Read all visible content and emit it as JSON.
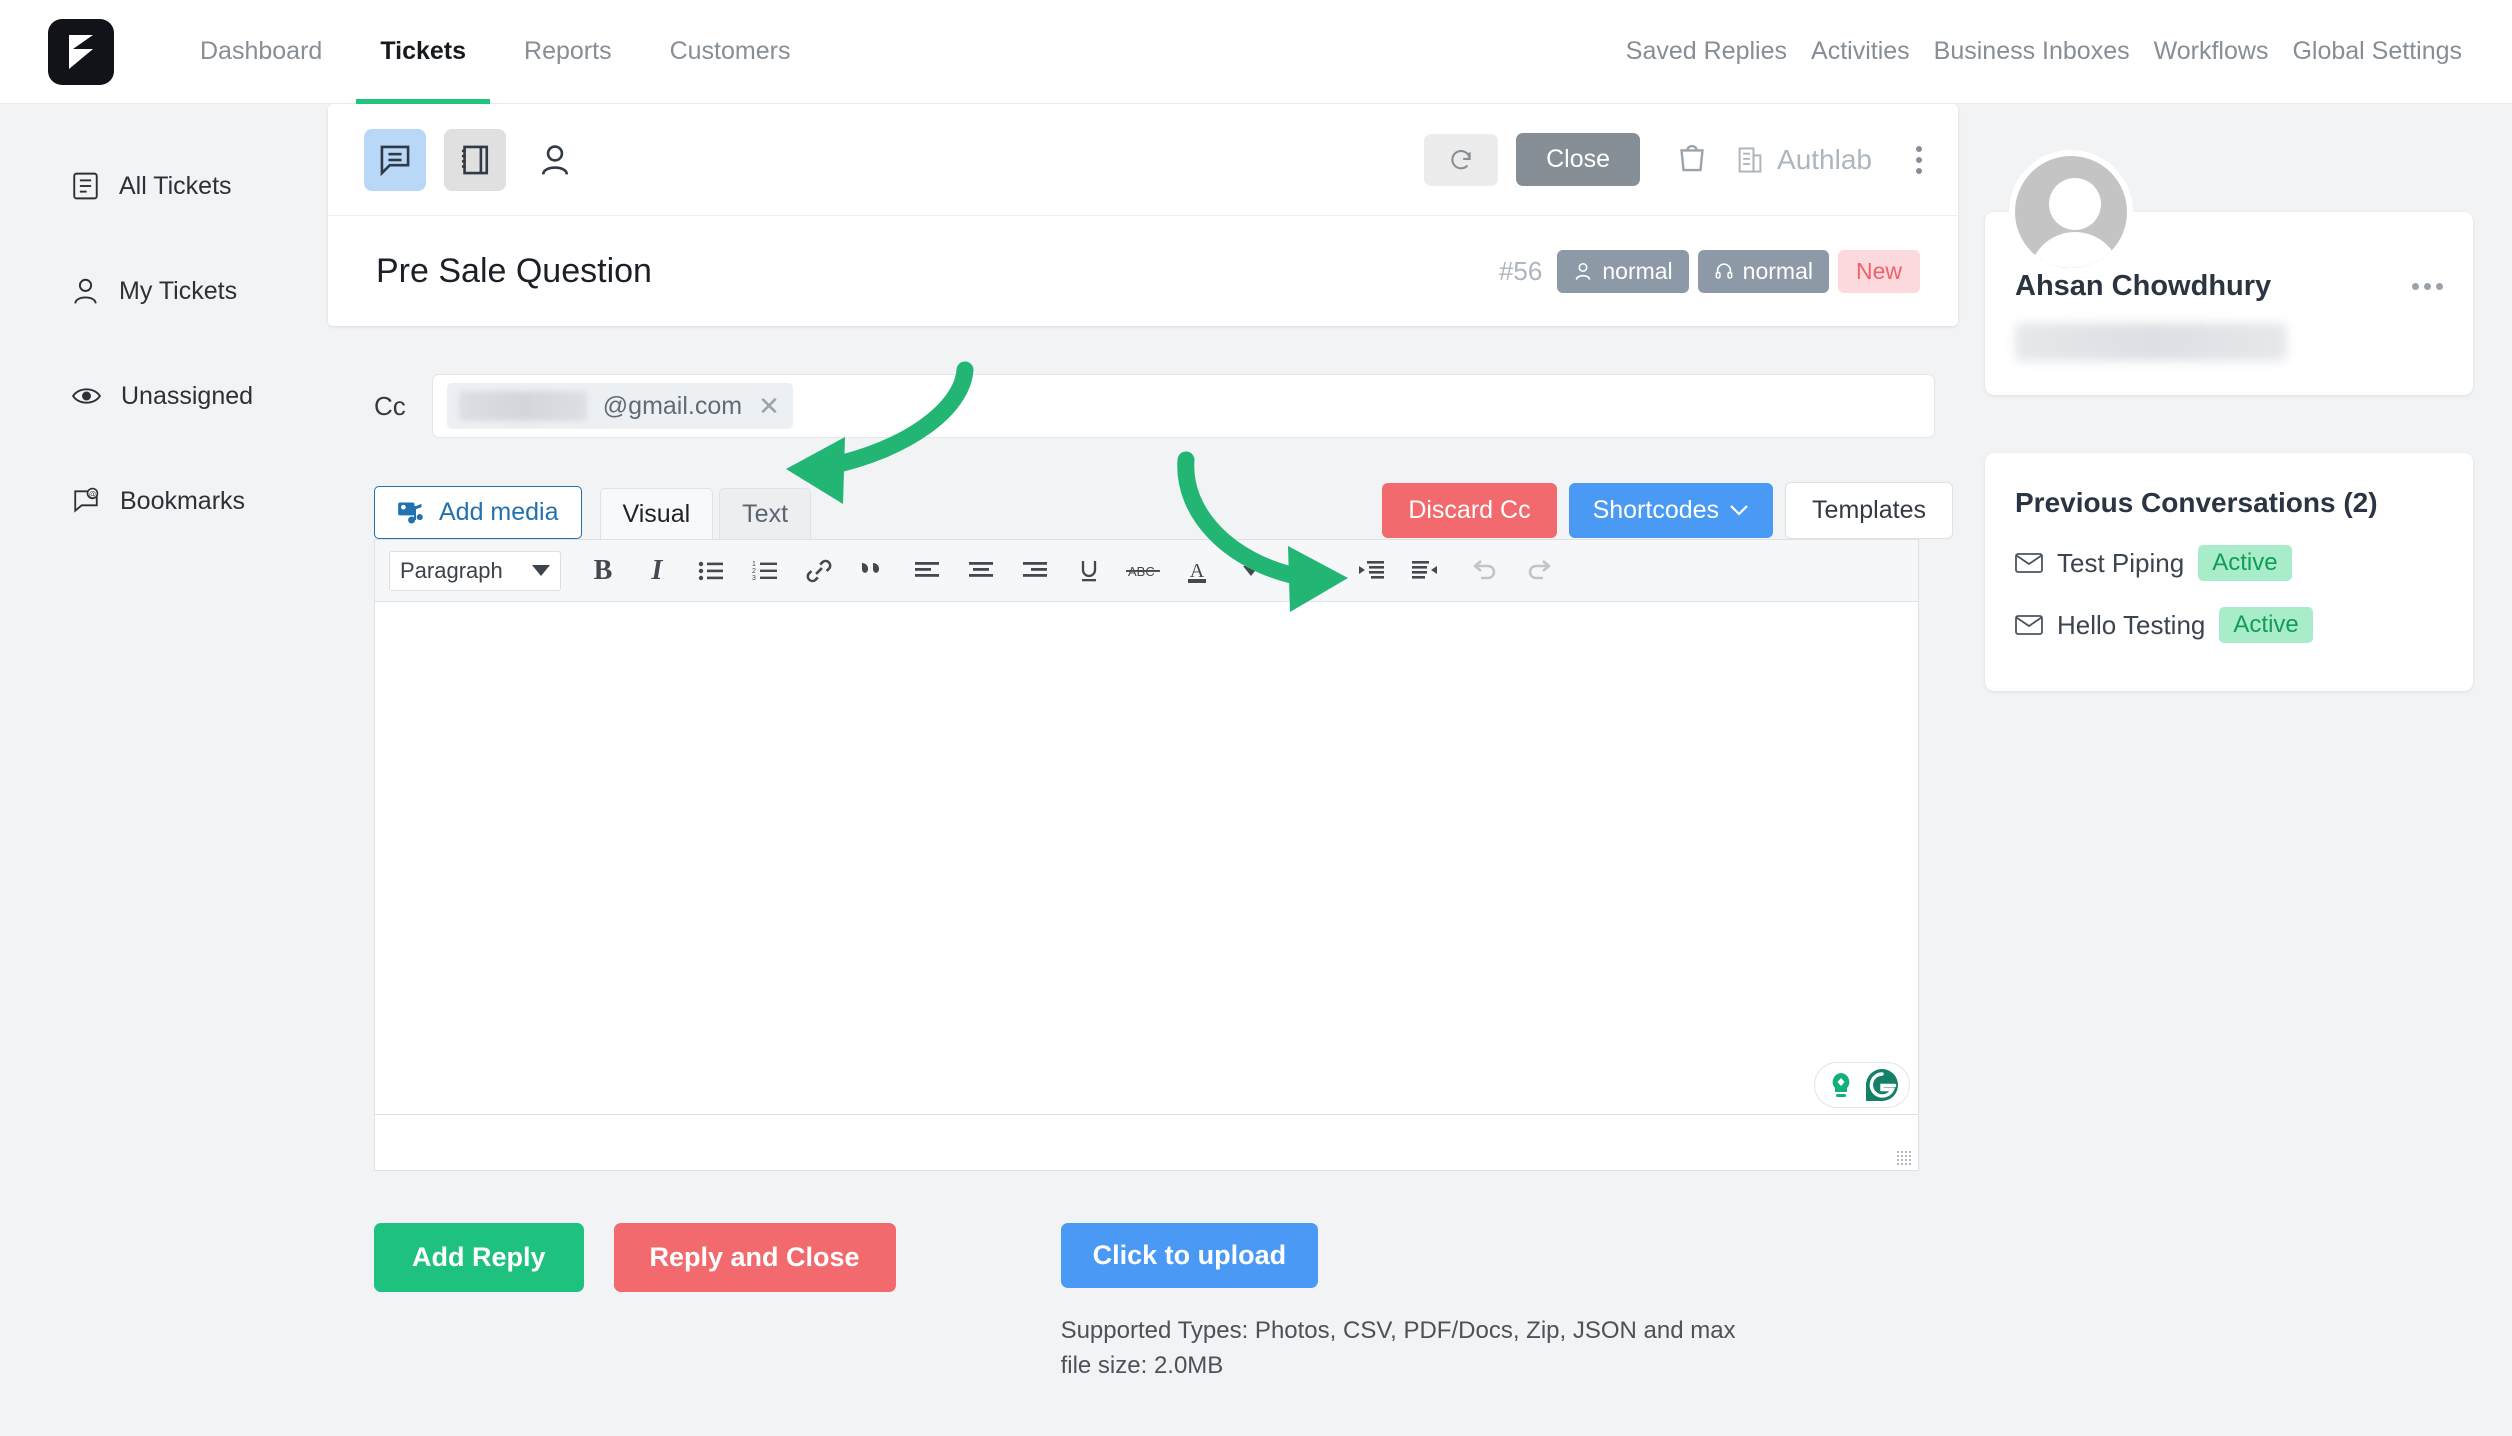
{
  "nav": {
    "logo": "fluent-support-logo",
    "left_items": [
      {
        "label": "Dashboard",
        "active": false
      },
      {
        "label": "Tickets",
        "active": true
      },
      {
        "label": "Reports",
        "active": false
      },
      {
        "label": "Customers",
        "active": false
      }
    ],
    "right_items": [
      {
        "label": "Saved Replies"
      },
      {
        "label": "Activities"
      },
      {
        "label": "Business Inboxes"
      },
      {
        "label": "Workflows"
      },
      {
        "label": "Global Settings"
      }
    ],
    "accent_color": "#22c27f"
  },
  "sidebar": {
    "items": [
      {
        "label": "All Tickets",
        "icon": "document-list-icon"
      },
      {
        "label": "My Tickets",
        "icon": "person-icon"
      },
      {
        "label": "Unassigned",
        "icon": "eye-icon"
      },
      {
        "label": "Bookmarks",
        "icon": "comment-at-icon"
      }
    ]
  },
  "ticket": {
    "toolbar": {
      "view_conversation_icon": "chat-bubble-icon",
      "view_notes_icon": "notebook-icon",
      "view_customer_icon": "person-icon",
      "refresh_icon": "refresh-icon",
      "close_label": "Close",
      "bag_icon": "shopping-bag-icon",
      "business_icon": "building-icon",
      "business_name": "Authlab",
      "more_icon": "kebab-menu-icon"
    },
    "title": "Pre Sale Question",
    "number": "#56",
    "badges": [
      {
        "label": "normal",
        "icon": "person-icon",
        "type": "priority",
        "color": "#8d99a6"
      },
      {
        "label": "normal",
        "icon": "headset-icon",
        "type": "support",
        "color": "#8d99a6"
      }
    ],
    "status": {
      "label": "New",
      "bg": "#fcd9dc",
      "fg": "#f1606d"
    }
  },
  "composer": {
    "cc_label": "Cc",
    "cc_tag": {
      "masked": true,
      "domain": "@gmail.com",
      "remove_icon": "close-x-icon"
    },
    "add_media_label": "Add media",
    "add_media_icon": "media-icon",
    "tabs": [
      {
        "label": "Visual",
        "active": true
      },
      {
        "label": "Text",
        "active": false
      }
    ],
    "discard_cc_label": "Discard Cc",
    "discard_cc_color": "#f2696e",
    "shortcodes_label": "Shortcodes",
    "shortcodes_color": "#4a9af5",
    "templates_label": "Templates",
    "editor": {
      "format_select": "Paragraph",
      "tools": [
        {
          "name": "bold-icon",
          "glyph": "B"
        },
        {
          "name": "italic-icon",
          "glyph": "I"
        },
        {
          "name": "bulleted-list-icon"
        },
        {
          "name": "numbered-list-icon"
        },
        {
          "name": "link-icon"
        },
        {
          "name": "blockquote-icon"
        },
        {
          "name": "align-left-icon"
        },
        {
          "name": "align-center-icon"
        },
        {
          "name": "align-right-icon"
        },
        {
          "name": "underline-icon",
          "glyph": "U"
        },
        {
          "name": "strikethrough-icon",
          "glyph": "ABC"
        },
        {
          "name": "text-color-icon",
          "glyph": "A"
        },
        {
          "name": "text-color-dropdown-icon"
        },
        {
          "name": "clear-formatting-icon"
        },
        {
          "name": "outdent-icon"
        },
        {
          "name": "indent-icon"
        },
        {
          "name": "undo-icon"
        },
        {
          "name": "redo-icon"
        }
      ],
      "body_text": "",
      "grammarly_icons": [
        "lightbulb-icon",
        "grammarly-g-icon"
      ],
      "resize_handle_icon": "resize-grip-icon"
    }
  },
  "actions": {
    "add_reply_label": "Add Reply",
    "add_reply_color": "#1fc17f",
    "reply_and_close_label": "Reply and Close",
    "reply_and_close_color": "#f2696e",
    "upload_label": "Click to upload",
    "upload_color": "#4a9af5",
    "upload_note": "Supported Types: Photos, CSV, PDF/Docs, Zip, JSON and max file size: 2.0MB"
  },
  "rail": {
    "avatar_icon": "default-avatar-icon",
    "customer_name": "Ahsan Chowdhury",
    "more_icon": "kebab-menu-icon",
    "conversations": {
      "title": "Previous Conversations (2)",
      "items": [
        {
          "label": "Test Piping",
          "status": "Active",
          "icon": "envelope-icon"
        },
        {
          "label": "Hello Testing",
          "status": "Active",
          "icon": "envelope-icon"
        }
      ],
      "status_bg": "#a8ecc9",
      "status_fg": "#0f9d58"
    }
  },
  "annotations": {
    "arrow_color": "#22b573",
    "arrows": [
      {
        "name": "arrow-to-cc-remove",
        "points_to": "cc-tag-remove-button"
      },
      {
        "name": "arrow-to-discard-cc",
        "points_to": "discard-cc-button"
      }
    ]
  }
}
